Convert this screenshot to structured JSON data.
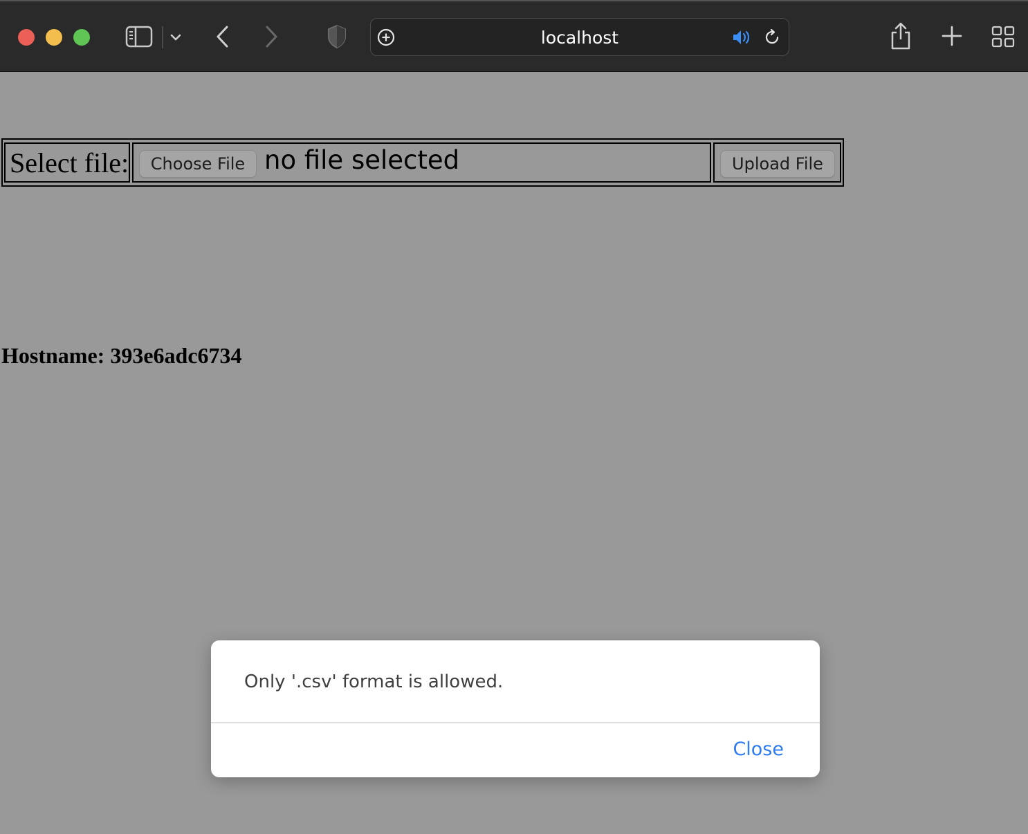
{
  "browser": {
    "address": "localhost",
    "icons": {
      "sidebar": "sidebar-icon",
      "tabs_menu": "chevron-down-icon",
      "back": "chevron-left-icon",
      "forward": "chevron-right-icon",
      "privacy": "shield-icon",
      "site_settings": "plus-circle-icon",
      "audio": "speaker-icon",
      "reload": "reload-icon",
      "share": "share-icon",
      "new_tab": "plus-icon",
      "tab_overview": "grid-icon"
    },
    "colors": {
      "close": "#ec5f57",
      "minimize": "#f3be4e",
      "zoom": "#5fc554",
      "audio_icon": "#3b8ef5"
    }
  },
  "form": {
    "label": "Select file:",
    "choose_button": "Choose File",
    "file_status": "no file selected",
    "upload_button": "Upload File"
  },
  "hostname": "Hostname: 393e6adc6734",
  "dialog": {
    "message": "Only '.csv' format is allowed.",
    "close_label": "Close",
    "accent": "#2f7bf0"
  }
}
